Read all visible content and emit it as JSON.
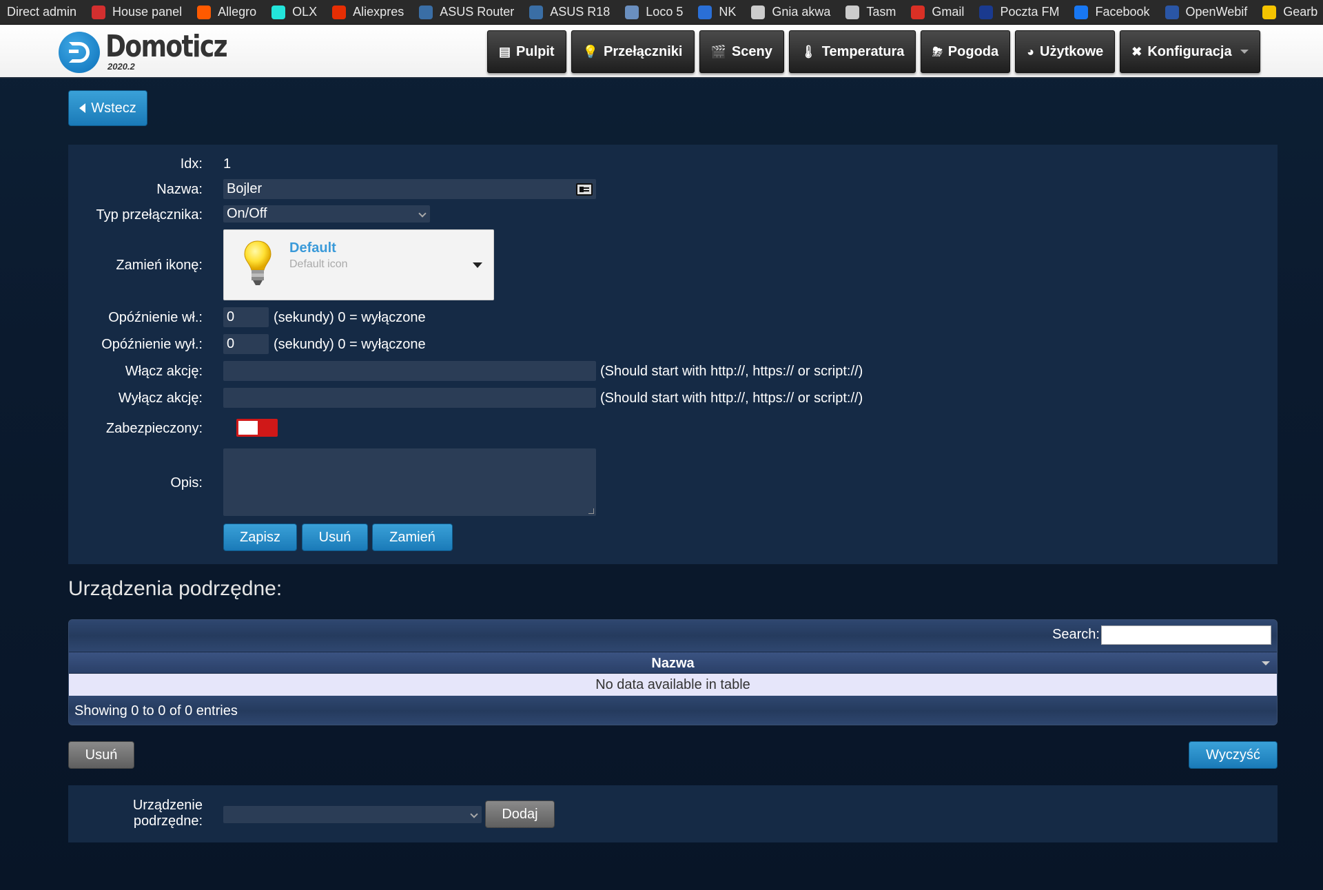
{
  "bookmarks": [
    {
      "label": "Direct admin",
      "icon": "",
      "color": "#2a2a2a"
    },
    {
      "label": "House panel",
      "icon": "house-panel-icon",
      "color": "#d32f2f"
    },
    {
      "label": "Allegro",
      "icon": "allegro-icon",
      "color": "#ff5a00"
    },
    {
      "label": "OLX",
      "icon": "olx-icon",
      "color": "#23e5db"
    },
    {
      "label": "Aliexpres",
      "icon": "aliexpress-icon",
      "color": "#e62e04"
    },
    {
      "label": "ASUS Router",
      "icon": "router-icon",
      "color": "#3a6ea5"
    },
    {
      "label": "ASUS R18",
      "icon": "router-icon",
      "color": "#3a6ea5"
    },
    {
      "label": "Loco 5",
      "icon": "loco-icon",
      "color": "#6a8fbf"
    },
    {
      "label": "NK",
      "icon": "nk-icon",
      "color": "#2a6fd6"
    },
    {
      "label": "Gnia akwa",
      "icon": "page-icon",
      "color": "#cccccc"
    },
    {
      "label": "Tasm",
      "icon": "page-icon",
      "color": "#cccccc"
    },
    {
      "label": "Gmail",
      "icon": "gmail-icon",
      "color": "#d93025"
    },
    {
      "label": "Poczta FM",
      "icon": "interia-icon",
      "color": "#1a3a8f"
    },
    {
      "label": "Facebook",
      "icon": "facebook-icon",
      "color": "#1877f2"
    },
    {
      "label": "OpenWebif",
      "icon": "openwebif-icon",
      "color": "#2a56a6"
    },
    {
      "label": "Gearb",
      "icon": "gearbest-icon",
      "color": "#f5c400"
    }
  ],
  "header": {
    "logo_text": "Domoticz",
    "version": "2020.2",
    "nav": [
      {
        "label": "Pulpit",
        "icon": "dashboard-icon",
        "glyph": "▤"
      },
      {
        "label": "Przełączniki",
        "icon": "lightbulb-icon",
        "glyph": "💡"
      },
      {
        "label": "Sceny",
        "icon": "clapper-icon",
        "glyph": "🎬"
      },
      {
        "label": "Temperatura",
        "icon": "thermometer-icon",
        "glyph": "🌡"
      },
      {
        "label": "Pogoda",
        "icon": "weather-icon",
        "glyph": "⛈"
      },
      {
        "label": "Użytkowe",
        "icon": "gauge-icon",
        "glyph": "◕"
      },
      {
        "label": "Konfiguracja",
        "icon": "tools-icon",
        "glyph": "✖"
      }
    ]
  },
  "back_label": "Wstecz",
  "form": {
    "idx_label": "Idx:",
    "idx_value": "1",
    "name_label": "Nazwa:",
    "name_value": "Bojler",
    "type_label": "Typ przełącznika:",
    "type_value": "On/Off",
    "icon_label": "Zamień ikonę:",
    "icon_title": "Default",
    "icon_sub": "Default icon",
    "on_delay_label": "Opóźnienie wł.:",
    "on_delay_value": "0",
    "off_delay_label": "Opóźnienie wył.:",
    "off_delay_value": "0",
    "delay_hint": "(sekundy) 0 = wyłączone",
    "on_action_label": "Włącz akcję:",
    "off_action_label": "Wyłącz akcję:",
    "action_hint": "(Should start with http://, https:// or script://)",
    "protected_label": "Zabezpieczony:",
    "protected": false,
    "description_label": "Opis:",
    "save": "Zapisz",
    "delete": "Usuń",
    "replace": "Zamień"
  },
  "subdevices": {
    "title": "Urządzenia podrzędne:",
    "search_label": "Search:",
    "column": "Nazwa",
    "empty": "No data available in table",
    "info": "Showing 0 to 0 of 0 entries",
    "delete": "Usuń",
    "clear": "Wyczyść",
    "add_label_1": "Urządzenie",
    "add_label_2": "podrzędne:",
    "add": "Dodaj"
  },
  "colors": {
    "accent": "#1f86c6",
    "panel": "#152a45",
    "danger": "#d01818"
  }
}
